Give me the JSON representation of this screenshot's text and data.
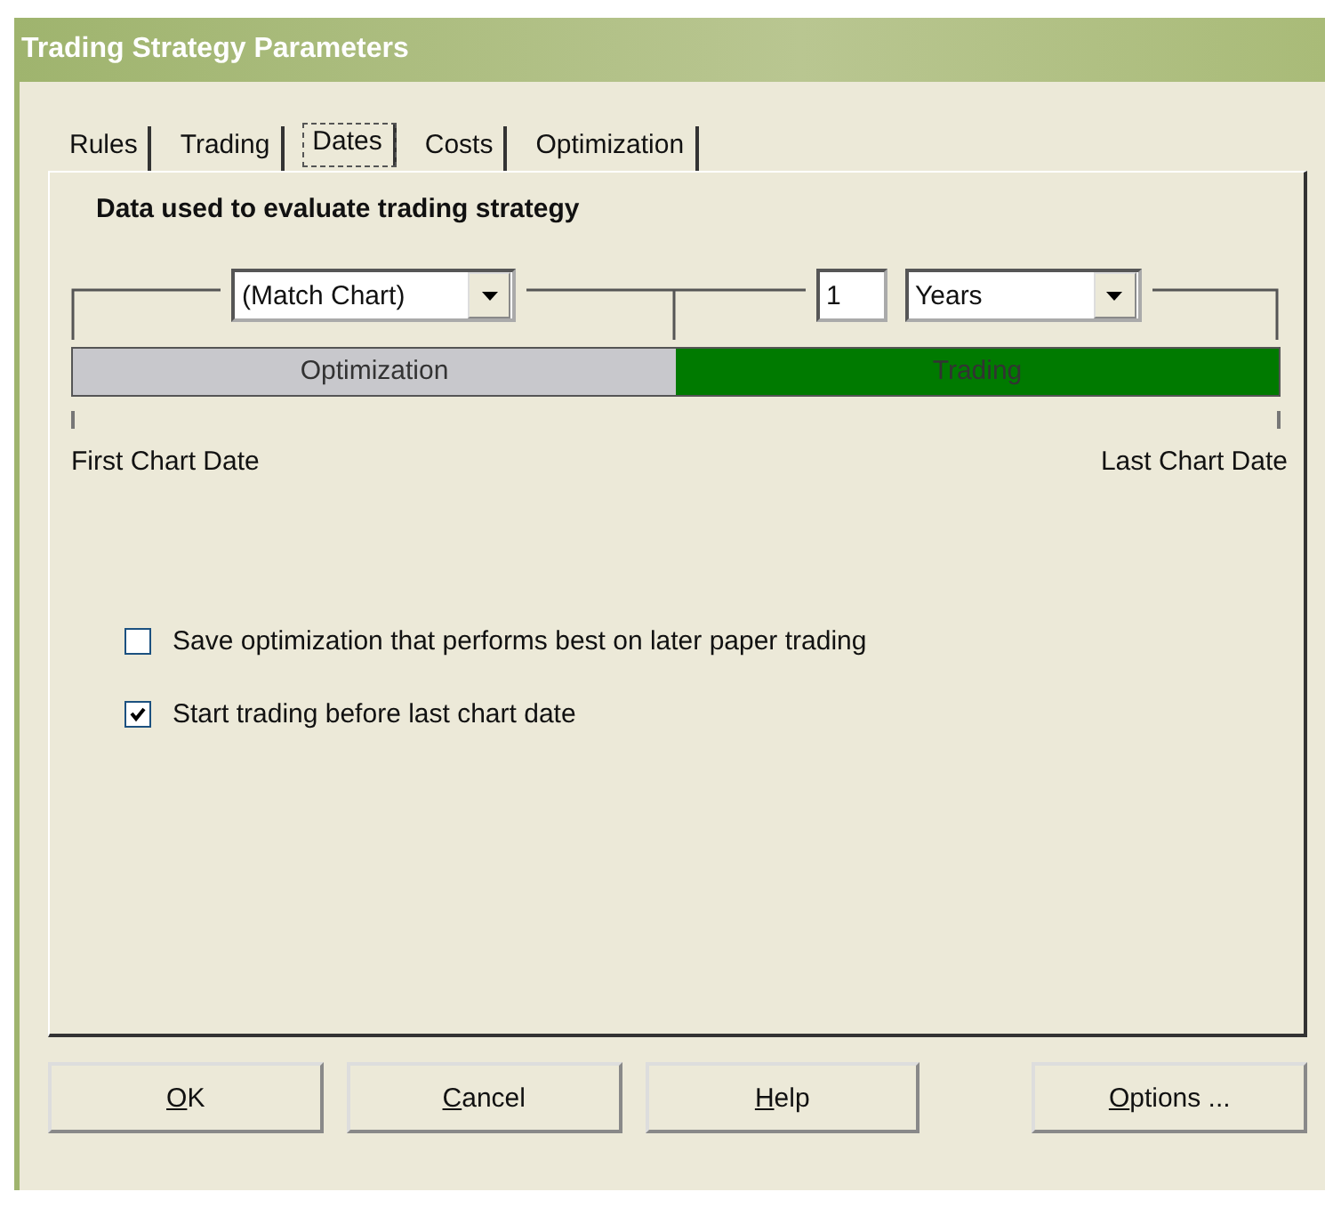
{
  "window": {
    "title": "Trading Strategy Parameters"
  },
  "tabs": [
    {
      "label": "Rules",
      "selected": false
    },
    {
      "label": "Trading",
      "selected": false
    },
    {
      "label": "Dates",
      "selected": true
    },
    {
      "label": "Costs",
      "selected": false
    },
    {
      "label": "Optimization",
      "selected": false
    }
  ],
  "heading": "Data used to evaluate trading strategy",
  "period_start": {
    "value": "(Match Chart)"
  },
  "trading_length": {
    "value": "1",
    "unit": "Years"
  },
  "segments": [
    {
      "label": "Optimization",
      "color": "#c8c8cc"
    },
    {
      "label": "Trading",
      "color": "#007a00"
    }
  ],
  "first_label": "First Chart Date",
  "last_label": "Last Chart Date",
  "options": [
    {
      "label": "Save optimization that performs best on later paper trading",
      "checked": false
    },
    {
      "label": "Start trading before last chart date",
      "checked": true
    }
  ],
  "buttons": [
    {
      "label": "OK",
      "underline_first": true
    },
    {
      "label": "Cancel",
      "underline_first": true
    },
    {
      "label": "Help",
      "underline_first": true
    },
    {
      "label": "Options ...",
      "underline_first": true
    }
  ]
}
